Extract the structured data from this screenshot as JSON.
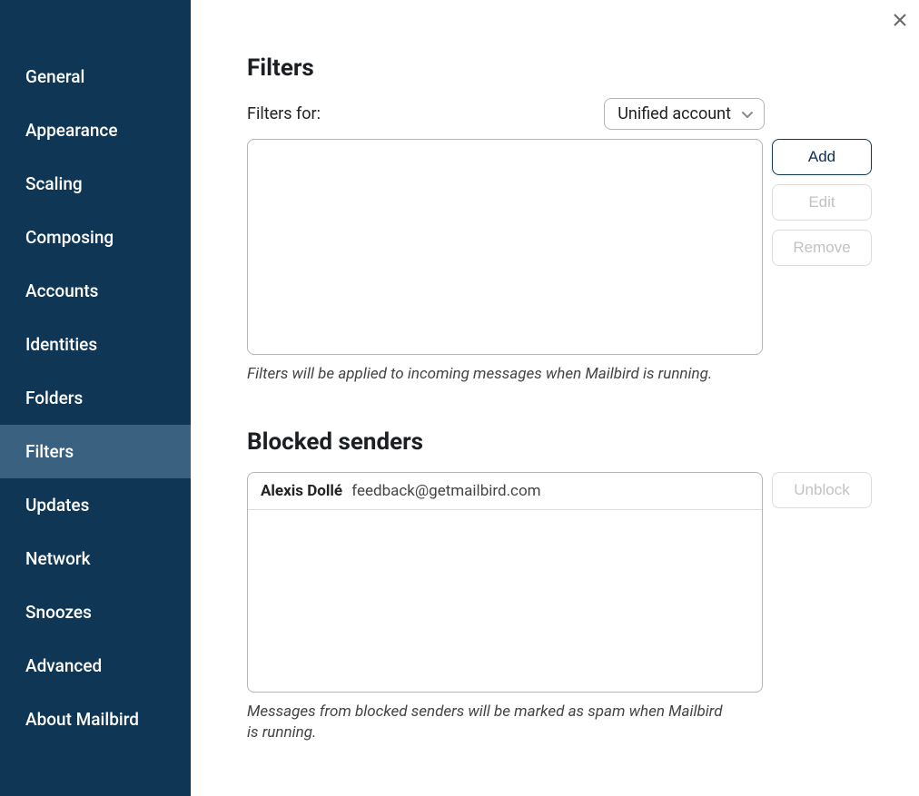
{
  "sidebar": {
    "items": [
      {
        "label": "General"
      },
      {
        "label": "Appearance"
      },
      {
        "label": "Scaling"
      },
      {
        "label": "Composing"
      },
      {
        "label": "Accounts"
      },
      {
        "label": "Identities"
      },
      {
        "label": "Folders"
      },
      {
        "label": "Filters"
      },
      {
        "label": "Updates"
      },
      {
        "label": "Network"
      },
      {
        "label": "Snoozes"
      },
      {
        "label": "Advanced"
      },
      {
        "label": "About Mailbird"
      }
    ],
    "active_index": 7
  },
  "filters": {
    "title": "Filters",
    "for_label": "Filters for:",
    "account_selected": "Unified account",
    "buttons": {
      "add": "Add",
      "edit": "Edit",
      "remove": "Remove"
    },
    "note": "Filters will be applied to incoming messages when Mailbird is running."
  },
  "blocked": {
    "title": "Blocked senders",
    "items": [
      {
        "name": "Alexis Dollé",
        "email": "feedback@getmailbird.com"
      }
    ],
    "unblock_label": "Unblock",
    "note": "Messages from blocked senders will be marked as spam when Mailbird is running."
  }
}
